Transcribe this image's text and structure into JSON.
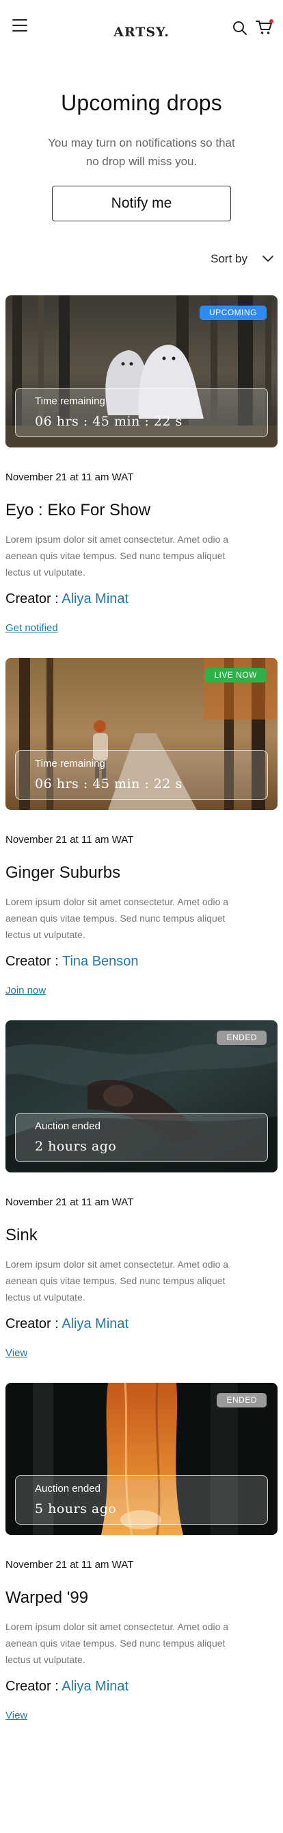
{
  "header": {
    "logo": "ARTSY.",
    "menu_icon": "hamburger-menu-icon",
    "search_icon": "search-icon",
    "cart_icon": "cart-icon"
  },
  "hero": {
    "title": "Upcoming drops",
    "subtitle": "You may turn on notifications so that no drop will miss you.",
    "notify_label": "Notify me"
  },
  "sort": {
    "label": "Sort by"
  },
  "drops": [
    {
      "badge": "UPCOMING",
      "badge_color": "#2f8bf0",
      "time_label": "Time remaining",
      "time_value": "06  hrs : 45 min : 22 s",
      "date": "November 21 at 11 am WAT",
      "title": "Eyo : Eko For Show",
      "description": "Lorem ipsum dolor sit amet consectetur. Amet odio a aenean quis vitae tempus. Sed nunc tempus aliquet lectus ut vulputate.",
      "creator_prefix": "Creator : ",
      "creator": "Aliya Minat",
      "action": "Get notified"
    },
    {
      "badge": "LIVE NOW",
      "badge_color": "#2bb34a",
      "time_label": "Time remaining",
      "time_value": "06  hrs : 45 min : 22 s",
      "date": "November 21 at 11 am WAT",
      "title": "Ginger Suburbs",
      "description": "Lorem ipsum dolor sit amet consectetur. Amet odio a aenean quis vitae tempus. Sed nunc tempus aliquet lectus ut vulputate.",
      "creator_prefix": "Creator : ",
      "creator": "Tina Benson",
      "action": "Join now"
    },
    {
      "badge": "ENDED",
      "badge_color": "#9a9a9a",
      "time_label": "Auction ended",
      "time_value": "2 hours ago",
      "date": "November 21 at 11 am WAT",
      "title": "Sink",
      "description": "Lorem ipsum dolor sit amet consectetur. Amet odio a aenean quis vitae tempus. Sed nunc tempus aliquet lectus ut vulputate.",
      "creator_prefix": "Creator : ",
      "creator": "Aliya Minat",
      "action": "View"
    },
    {
      "badge": "ENDED",
      "badge_color": "#9a9a9a",
      "time_label": "Auction ended",
      "time_value": "5 hours ago",
      "date": "November 21 at 11 am WAT",
      "title": "Warped '99",
      "description": "Lorem ipsum dolor sit amet consectetur. Amet odio a aenean quis vitae tempus. Sed nunc tempus aliquet lectus ut vulputate.",
      "creator_prefix": "Creator : ",
      "creator": "Aliya Minat",
      "action": "View"
    }
  ],
  "colors": {
    "link": "#1d79a7",
    "upcoming": "#2f8bf0",
    "live": "#2bb34a",
    "ended": "#9a9a9a"
  }
}
